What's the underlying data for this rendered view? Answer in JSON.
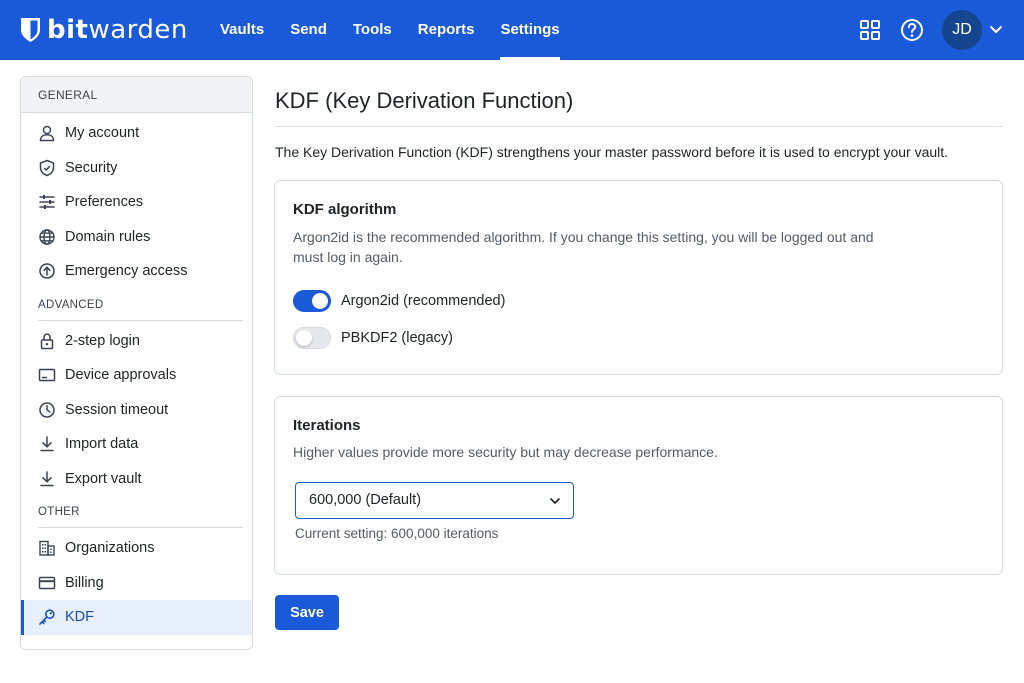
{
  "brand": {
    "name_bold": "bit",
    "name_rest": "warden"
  },
  "nav": {
    "links": [
      {
        "label": "Vaults"
      },
      {
        "label": "Send"
      },
      {
        "label": "Tools"
      },
      {
        "label": "Reports"
      },
      {
        "label": "Settings",
        "active": true
      }
    ],
    "apps_icon": "grid-icon",
    "help_icon": "help-icon",
    "avatar_initials": "JD"
  },
  "sidebar": {
    "header": "GENERAL",
    "general": [
      {
        "label": "My account",
        "icon": "user-icon"
      },
      {
        "label": "Security",
        "icon": "shield-icon"
      },
      {
        "label": "Preferences",
        "icon": "sliders-icon"
      },
      {
        "label": "Domain rules",
        "icon": "globe-icon"
      },
      {
        "label": "Emergency access",
        "icon": "emergency-icon"
      }
    ],
    "advanced_header": "ADVANCED",
    "advanced": [
      {
        "label": "2-step login",
        "icon": "lock-icon"
      },
      {
        "label": "Device approvals",
        "icon": "device-icon"
      },
      {
        "label": "Session timeout",
        "icon": "clock-icon"
      },
      {
        "label": "Import data",
        "icon": "download-icon"
      },
      {
        "label": "Export vault",
        "icon": "download-icon"
      }
    ],
    "other_header": "OTHER",
    "other": [
      {
        "label": "Organizations",
        "icon": "building-icon"
      },
      {
        "label": "Billing",
        "icon": "card-icon"
      },
      {
        "label": "KDF",
        "icon": "key-icon",
        "active": true
      }
    ]
  },
  "main": {
    "title": "KDF (Key Derivation Function)",
    "intro": "The Key Derivation Function (KDF) strengthens your master password before it is used to encrypt your vault.",
    "algorithm": {
      "title": "KDF algorithm",
      "desc_line1": "Argon2id is the recommended algorithm. If you change this setting, you will be logged out and",
      "desc_line2": "must log in again.",
      "options": [
        {
          "label": "Argon2id (recommended)",
          "checked": true
        },
        {
          "label": "PBKDF2 (legacy)",
          "checked": false
        }
      ]
    },
    "iterations": {
      "title": "Iterations",
      "desc": "Higher values provide more security but may decrease performance.",
      "selected": "600,000 (Default)",
      "current": "Current setting: 600,000 iterations"
    },
    "save_label": "Save"
  },
  "colors": {
    "primary": "#1a5ad9",
    "nav_bg": "#1a5ad9",
    "avatar_bg": "#14458f"
  }
}
